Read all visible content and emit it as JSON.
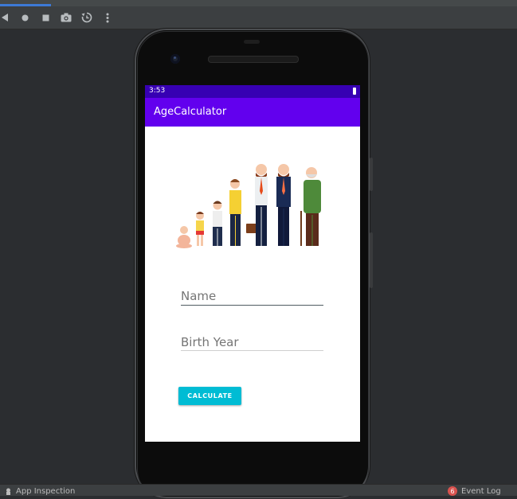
{
  "ide": {
    "toolbar": {
      "buttons": [
        {
          "icon": "back-triangle-icon"
        },
        {
          "icon": "home-circle-icon"
        },
        {
          "icon": "overview-square-icon"
        },
        {
          "icon": "camera-icon"
        },
        {
          "icon": "rotate-icon"
        },
        {
          "icon": "more-vertical-icon"
        }
      ]
    },
    "bottom": {
      "left_label": "App Inspection",
      "right_badge": "6",
      "right_label": "Event Log"
    }
  },
  "device": {
    "status_time": "3:53",
    "app_title": "AgeCalculator",
    "name_field": {
      "placeholder": "Name",
      "value": ""
    },
    "year_field": {
      "placeholder": "Birth Year",
      "value": ""
    },
    "calculate_label": "CALCULATE"
  },
  "colors": {
    "status_bar": "#3700b3",
    "app_bar": "#6200ee",
    "button": "#00bcd4"
  }
}
